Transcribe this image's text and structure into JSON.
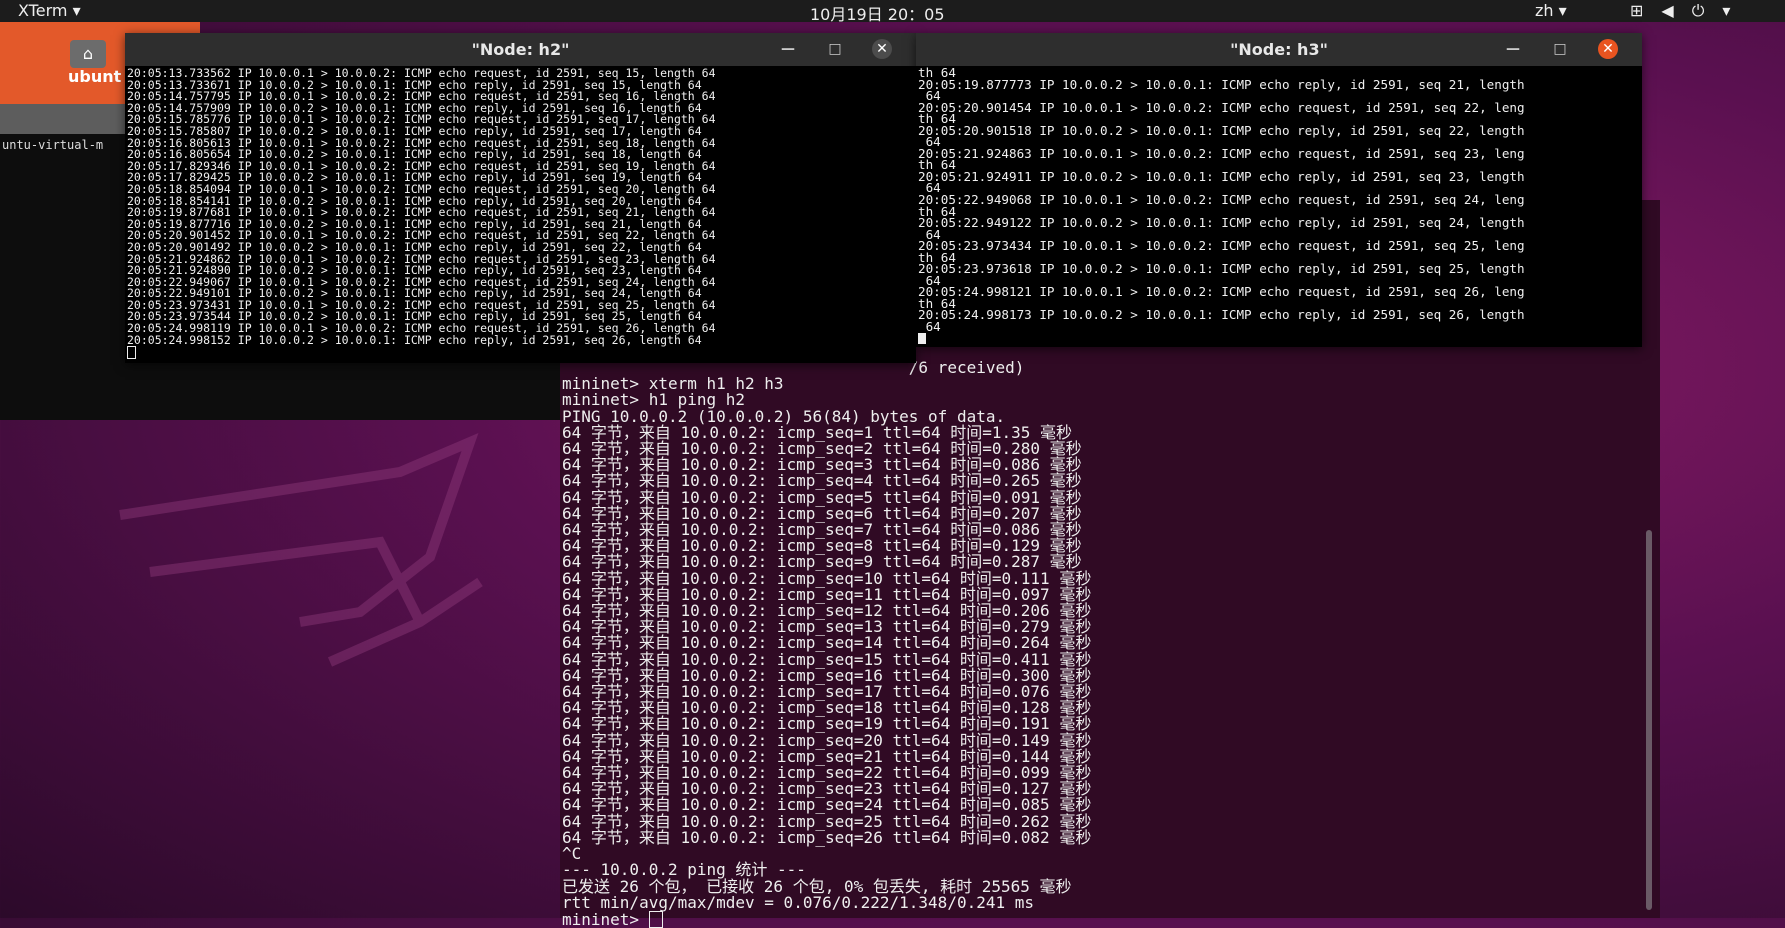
{
  "topbar": {
    "app_menu": "XTerm",
    "clock": "10月19日 20：05",
    "lang": "zh"
  },
  "desktop": {
    "folder_label": "ubunt",
    "strip_text": "untu-virtual-m"
  },
  "h2": {
    "title": "\"Node: h2\"",
    "lines": [
      "20:05:13.733562 IP 10.0.0.1 > 10.0.0.2: ICMP echo request, id 2591, seq 15, length 64",
      "20:05:13.733671 IP 10.0.0.2 > 10.0.0.1: ICMP echo reply, id 2591, seq 15, length 64",
      "20:05:14.757795 IP 10.0.0.1 > 10.0.0.2: ICMP echo request, id 2591, seq 16, length 64",
      "20:05:14.757909 IP 10.0.0.2 > 10.0.0.1: ICMP echo reply, id 2591, seq 16, length 64",
      "20:05:15.785776 IP 10.0.0.1 > 10.0.0.2: ICMP echo request, id 2591, seq 17, length 64",
      "20:05:15.785807 IP 10.0.0.2 > 10.0.0.1: ICMP echo reply, id 2591, seq 17, length 64",
      "20:05:16.805613 IP 10.0.0.1 > 10.0.0.2: ICMP echo request, id 2591, seq 18, length 64",
      "20:05:16.805654 IP 10.0.0.2 > 10.0.0.1: ICMP echo reply, id 2591, seq 18, length 64",
      "20:05:17.829346 IP 10.0.0.1 > 10.0.0.2: ICMP echo request, id 2591, seq 19, length 64",
      "20:05:17.829425 IP 10.0.0.2 > 10.0.0.1: ICMP echo reply, id 2591, seq 19, length 64",
      "20:05:18.854094 IP 10.0.0.1 > 10.0.0.2: ICMP echo request, id 2591, seq 20, length 64",
      "20:05:18.854141 IP 10.0.0.2 > 10.0.0.1: ICMP echo reply, id 2591, seq 20, length 64",
      "20:05:19.877681 IP 10.0.0.1 > 10.0.0.2: ICMP echo request, id 2591, seq 21, length 64",
      "20:05:19.877716 IP 10.0.0.2 > 10.0.0.1: ICMP echo reply, id 2591, seq 21, length 64",
      "20:05:20.901452 IP 10.0.0.1 > 10.0.0.2: ICMP echo request, id 2591, seq 22, length 64",
      "20:05:20.901492 IP 10.0.0.2 > 10.0.0.1: ICMP echo reply, id 2591, seq 22, length 64",
      "20:05:21.924862 IP 10.0.0.1 > 10.0.0.2: ICMP echo request, id 2591, seq 23, length 64",
      "20:05:21.924890 IP 10.0.0.2 > 10.0.0.1: ICMP echo reply, id 2591, seq 23, length 64",
      "20:05:22.949067 IP 10.0.0.1 > 10.0.0.2: ICMP echo request, id 2591, seq 24, length 64",
      "20:05:22.949101 IP 10.0.0.2 > 10.0.0.1: ICMP echo reply, id 2591, seq 24, length 64",
      "20:05:23.973431 IP 10.0.0.1 > 10.0.0.2: ICMP echo request, id 2591, seq 25, length 64",
      "20:05:23.973544 IP 10.0.0.2 > 10.0.0.1: ICMP echo reply, id 2591, seq 25, length 64",
      "20:05:24.998119 IP 10.0.0.1 > 10.0.0.2: ICMP echo request, id 2591, seq 26, length 64",
      "20:05:24.998152 IP 10.0.0.2 > 10.0.0.1: ICMP echo reply, id 2591, seq 26, length 64"
    ]
  },
  "h3": {
    "title": "\"Node: h3\"",
    "lines": [
      "th 64",
      "20:05:19.877773 IP 10.0.0.2 > 10.0.0.1: ICMP echo reply, id 2591, seq 21, length",
      " 64",
      "20:05:20.901454 IP 10.0.0.1 > 10.0.0.2: ICMP echo request, id 2591, seq 22, leng",
      "th 64",
      "20:05:20.901518 IP 10.0.0.2 > 10.0.0.1: ICMP echo reply, id 2591, seq 22, length",
      " 64",
      "20:05:21.924863 IP 10.0.0.1 > 10.0.0.2: ICMP echo request, id 2591, seq 23, leng",
      "th 64",
      "20:05:21.924911 IP 10.0.0.2 > 10.0.0.1: ICMP echo reply, id 2591, seq 23, length",
      " 64",
      "20:05:22.949068 IP 10.0.0.1 > 10.0.0.2: ICMP echo request, id 2591, seq 24, leng",
      "th 64",
      "20:05:22.949122 IP 10.0.0.2 > 10.0.0.1: ICMP echo reply, id 2591, seq 24, length",
      " 64",
      "20:05:23.973434 IP 10.0.0.1 > 10.0.0.2: ICMP echo request, id 2591, seq 25, leng",
      "th 64",
      "20:05:23.973618 IP 10.0.0.2 > 10.0.0.1: ICMP echo reply, id 2591, seq 25, length",
      " 64",
      "20:05:24.998121 IP 10.0.0.1 > 10.0.0.2: ICMP echo request, id 2591, seq 26, leng",
      "th 64",
      "20:05:24.998173 IP 10.0.0.2 > 10.0.0.1: ICMP echo reply, id 2591, seq 26, length",
      " 64"
    ]
  },
  "main": {
    "lines": [
      "                                    /6 received)",
      "mininet> xterm h1 h2 h3",
      "mininet> h1 ping h2",
      "PING 10.0.0.2 (10.0.0.2) 56(84) bytes of data.",
      "64 字节，来自 10.0.0.2: icmp_seq=1 ttl=64 时间=1.35 毫秒",
      "64 字节，来自 10.0.0.2: icmp_seq=2 ttl=64 时间=0.280 毫秒",
      "64 字节，来自 10.0.0.2: icmp_seq=3 ttl=64 时间=0.086 毫秒",
      "64 字节，来自 10.0.0.2: icmp_seq=4 ttl=64 时间=0.265 毫秒",
      "64 字节，来自 10.0.0.2: icmp_seq=5 ttl=64 时间=0.091 毫秒",
      "64 字节，来自 10.0.0.2: icmp_seq=6 ttl=64 时间=0.207 毫秒",
      "64 字节，来自 10.0.0.2: icmp_seq=7 ttl=64 时间=0.086 毫秒",
      "64 字节，来自 10.0.0.2: icmp_seq=8 ttl=64 时间=0.129 毫秒",
      "64 字节，来自 10.0.0.2: icmp_seq=9 ttl=64 时间=0.287 毫秒",
      "64 字节，来自 10.0.0.2: icmp_seq=10 ttl=64 时间=0.111 毫秒",
      "64 字节，来自 10.0.0.2: icmp_seq=11 ttl=64 时间=0.097 毫秒",
      "64 字节，来自 10.0.0.2: icmp_seq=12 ttl=64 时间=0.206 毫秒",
      "64 字节，来自 10.0.0.2: icmp_seq=13 ttl=64 时间=0.279 毫秒",
      "64 字节，来自 10.0.0.2: icmp_seq=14 ttl=64 时间=0.264 毫秒",
      "64 字节，来自 10.0.0.2: icmp_seq=15 ttl=64 时间=0.411 毫秒",
      "64 字节，来自 10.0.0.2: icmp_seq=16 ttl=64 时间=0.300 毫秒",
      "64 字节，来自 10.0.0.2: icmp_seq=17 ttl=64 时间=0.076 毫秒",
      "64 字节，来自 10.0.0.2: icmp_seq=18 ttl=64 时间=0.128 毫秒",
      "64 字节，来自 10.0.0.2: icmp_seq=19 ttl=64 时间=0.191 毫秒",
      "64 字节，来自 10.0.0.2: icmp_seq=20 ttl=64 时间=0.149 毫秒",
      "64 字节，来自 10.0.0.2: icmp_seq=21 ttl=64 时间=0.144 毫秒",
      "64 字节，来自 10.0.0.2: icmp_seq=22 ttl=64 时间=0.099 毫秒",
      "64 字节，来自 10.0.0.2: icmp_seq=23 ttl=64 时间=0.127 毫秒",
      "64 字节，来自 10.0.0.2: icmp_seq=24 ttl=64 时间=0.085 毫秒",
      "64 字节，来自 10.0.0.2: icmp_seq=25 ttl=64 时间=0.262 毫秒",
      "64 字节，来自 10.0.0.2: icmp_seq=26 ttl=64 时间=0.082 毫秒",
      "^C",
      "--- 10.0.0.2 ping 统计 ---",
      "已发送 26 个包， 已接收 26 个包, 0% 包丢失, 耗时 25565 毫秒",
      "rtt min/avg/max/mdev = 0.076/0.222/1.348/0.241 ms"
    ],
    "prompt": "mininet> "
  }
}
